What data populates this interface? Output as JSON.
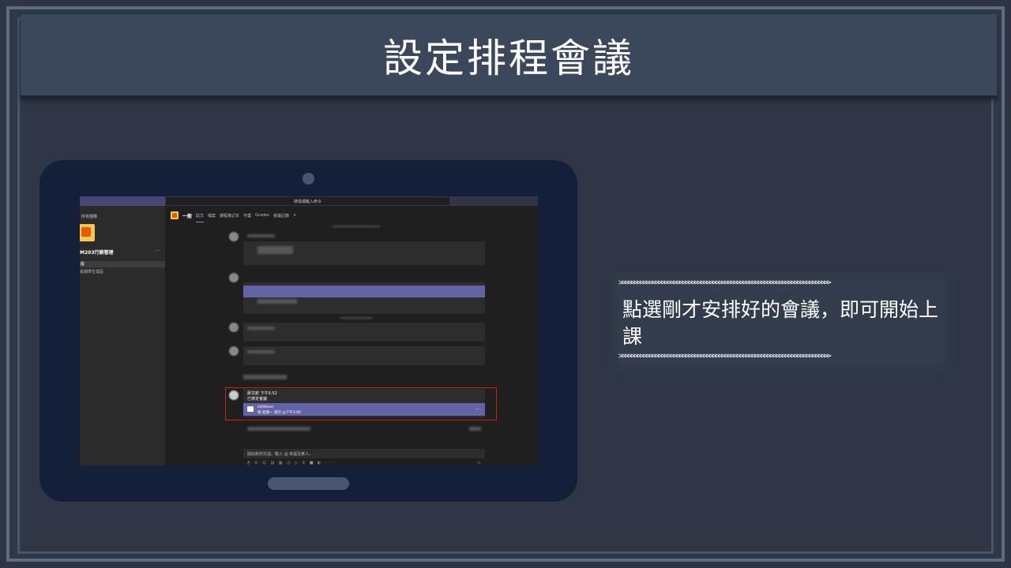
{
  "slide": {
    "title": "設定排程會議",
    "note": "點選剛才安排好的會議，即可開始上課",
    "deco_arrows": ">>>>>>>>>>>>>>>>>>>>>>>>>>>>>>>>>>>>>>>>>>>>>>>>>>>>>>>>>>>>>>>>>>>>>>"
  },
  "teams": {
    "command_placeholder": "搜尋或輸入命令",
    "all_teams": "所有團隊",
    "team_name": "M203行銷管理",
    "team_more": "···",
    "channel_selected": "般",
    "channel_2": "長期學生需區",
    "tabs": [
      "一般",
      "貼文",
      "檔案",
      "課程筆記本",
      "作業",
      "Grades",
      "會議記錄",
      "+"
    ],
    "message_sender": "廖文欽   下午5:52",
    "message_text": "已排定會議",
    "meeting_title": "0406test",
    "meeting_time": "每 星期一 發行 @下午3:00",
    "meeting_more": "···",
    "compose_placeholder": "開始新的交談。輸入 @ 來提及某人。",
    "tool_icons": "A̲ ⊘ ☺ ▤ ▦ ◷ ▷ ♀ ■ ◐ ···",
    "send_icon": "▷"
  },
  "colors": {
    "accent_purple": "#6264a7",
    "highlight_red": "#d11c1c",
    "tablet": "#141f3a"
  }
}
